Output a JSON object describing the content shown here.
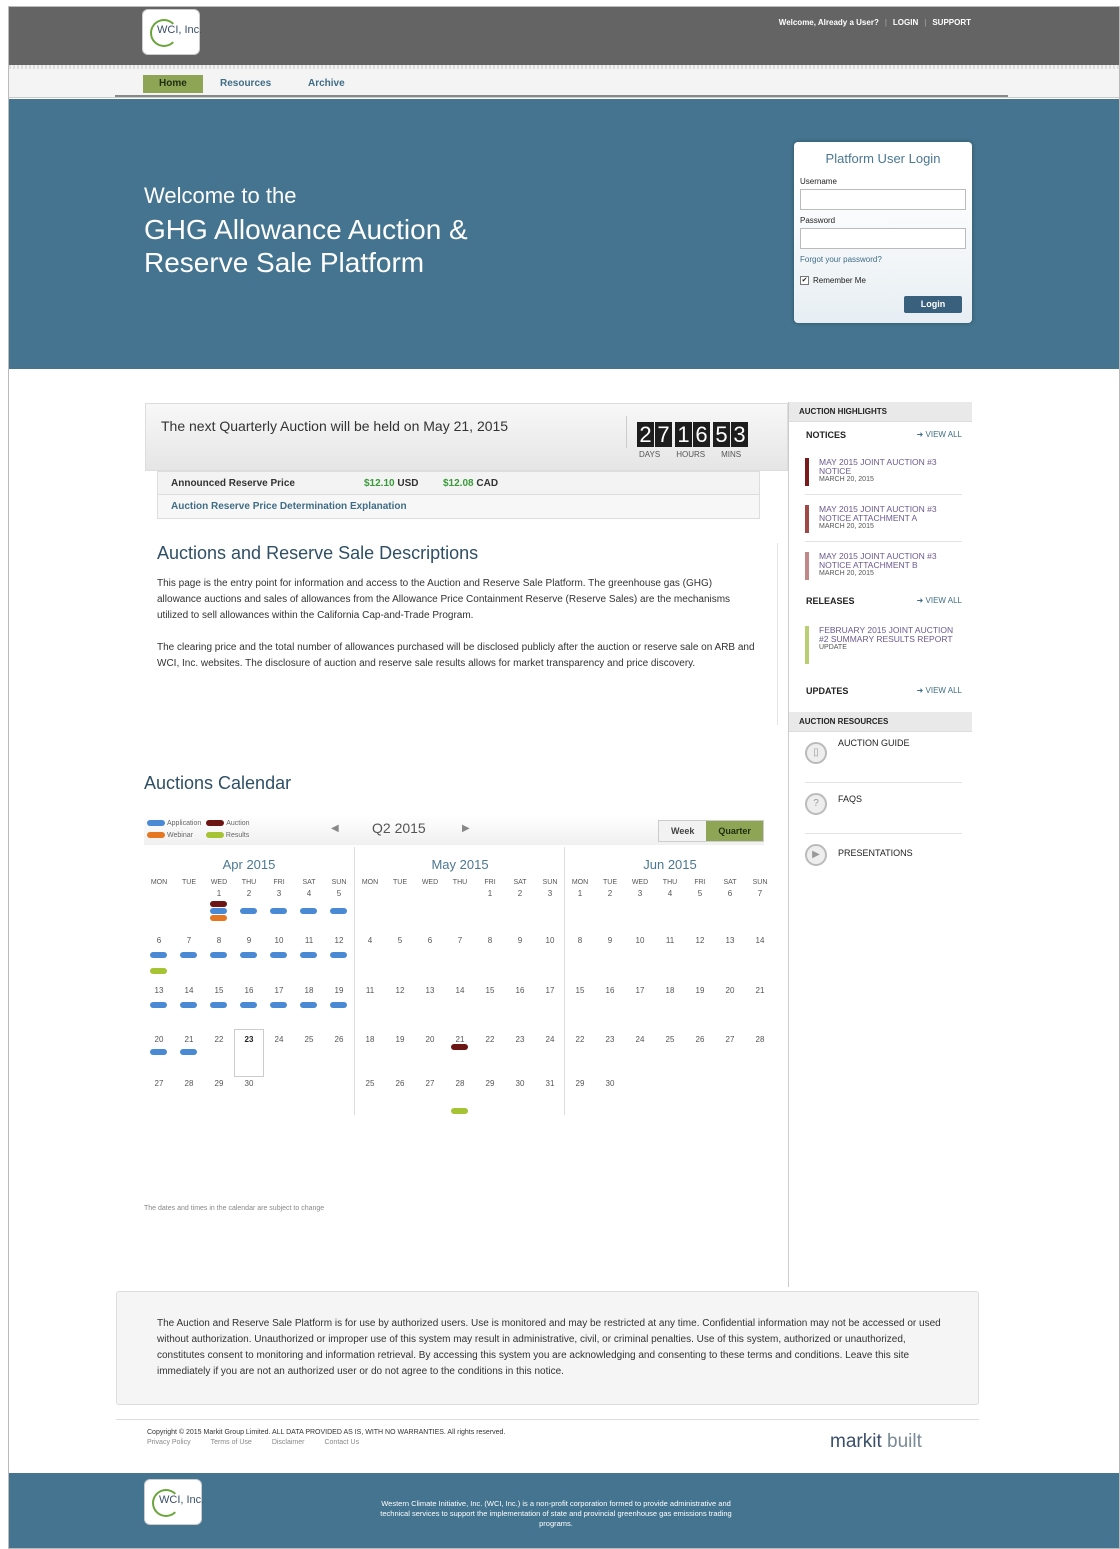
{
  "header": {
    "logo_text": "WCI, Inc.",
    "welcome": "Welcome, Already a User?",
    "login_link": "LOGIN",
    "support_link": "SUPPORT"
  },
  "nav": {
    "home": "Home",
    "resources": "Resources",
    "archive": "Archive"
  },
  "hero": {
    "line1": "Welcome to the",
    "line2": "GHG Allowance Auction &",
    "line3": "Reserve Sale Platform"
  },
  "login": {
    "title": "Platform User Login",
    "username_label": "Username",
    "password_label": "Password",
    "forgot": "Forgot your password?",
    "remember": "Remember Me",
    "button": "Login"
  },
  "auction": {
    "message": "The next Quarterly Auction will be held on May 21, 2015",
    "digits": [
      "2",
      "7",
      "1",
      "6",
      "5",
      "3"
    ],
    "labels": [
      "DAYS",
      "HOURS",
      "MINS"
    ],
    "reserve_label": "Announced Reserve Price",
    "usd_value": "$12.10",
    "usd_unit": "USD",
    "cad_value": "$12.08",
    "cad_unit": "CAD",
    "explanation_link": "Auction Reserve Price Determination Explanation"
  },
  "descriptions": {
    "title": "Auctions and Reserve Sale Descriptions",
    "p1": "This page is the entry point for information and access to the Auction and Reserve Sale Platform. The greenhouse gas (GHG) allowance auctions and sales of allowances from the Allowance Price Containment Reserve (Reserve Sales) are the mechanisms utilized to sell allowances within the California Cap-and-Trade Program.",
    "p2": "The clearing price and the total number of allowances purchased will be disclosed publicly after the auction or reserve sale on ARB and WCI, Inc. websites. The disclosure of auction and reserve sale results allows for market transparency and price discovery."
  },
  "calendar": {
    "title": "Auctions Calendar",
    "legend": {
      "application": "Application",
      "auction": "Auction",
      "webinar": "Webinar",
      "results": "Results"
    },
    "period": "Q2 2015",
    "week": "Week",
    "quarter": "Quarter",
    "months": [
      "Apr 2015",
      "May 2015",
      "Jun 2015"
    ],
    "dow": [
      "MON",
      "TUE",
      "WED",
      "THU",
      "FRI",
      "SAT",
      "SUN"
    ],
    "apr_days": [
      [
        "",
        "",
        "1",
        "2",
        "3",
        "4",
        "5"
      ],
      [
        "6",
        "7",
        "8",
        "9",
        "10",
        "11",
        "12"
      ],
      [
        "13",
        "14",
        "15",
        "16",
        "17",
        "18",
        "19"
      ],
      [
        "20",
        "21",
        "22",
        "23",
        "24",
        "25",
        "26"
      ],
      [
        "27",
        "28",
        "29",
        "30",
        "",
        "",
        ""
      ]
    ],
    "may_days": [
      [
        "",
        "",
        "",
        "",
        "1",
        "2",
        "3"
      ],
      [
        "4",
        "5",
        "6",
        "7",
        "8",
        "9",
        "10"
      ],
      [
        "11",
        "12",
        "13",
        "14",
        "15",
        "16",
        "17"
      ],
      [
        "18",
        "19",
        "20",
        "21",
        "22",
        "23",
        "24"
      ],
      [
        "25",
        "26",
        "27",
        "28",
        "29",
        "30",
        "31"
      ]
    ],
    "jun_days": [
      [
        "1",
        "2",
        "3",
        "4",
        "5",
        "6",
        "7"
      ],
      [
        "8",
        "9",
        "10",
        "11",
        "12",
        "13",
        "14"
      ],
      [
        "15",
        "16",
        "17",
        "18",
        "19",
        "20",
        "21"
      ],
      [
        "22",
        "23",
        "24",
        "25",
        "26",
        "27",
        "28"
      ],
      [
        "29",
        "30",
        "",
        "",
        "",
        "",
        ""
      ]
    ],
    "disclaimer": "The dates and times in the calendar are subject to change"
  },
  "sidebar": {
    "highlights": "AUCTION HIGHLIGHTS",
    "notices": "NOTICES",
    "view_all": "VIEW ALL",
    "notice_items": [
      {
        "title": "MAY 2015 JOINT AUCTION #3 NOTICE",
        "date": "MARCH 20, 2015",
        "color": "#7a1a1a"
      },
      {
        "title": "MAY 2015 JOINT AUCTION #3 NOTICE ATTACHMENT A",
        "date": "MARCH 20, 2015",
        "color": "#a04848"
      },
      {
        "title": "MAY 2015 JOINT AUCTION #3 NOTICE ATTACHMENT B",
        "date": "MARCH 20, 2015",
        "color": "#c08888"
      }
    ],
    "releases": "RELEASES",
    "release_items": [
      {
        "title": "FEBRUARY 2015 JOINT AUCTION #2 SUMMARY RESULTS REPORT",
        "date": "UPDATE",
        "color": "#b8cf72"
      }
    ],
    "updates": "UPDATES",
    "resources_head": "AUCTION RESOURCES",
    "resources": [
      "AUCTION GUIDE",
      "FAQS",
      "PRESENTATIONS"
    ]
  },
  "legal": "The Auction and Reserve Sale Platform is for use by authorized users. Use is monitored and may be restricted at any time. Confidential information may not be accessed or used without authorization. Unauthorized or improper use of this system may result in administrative, civil, or criminal penalties. Use of this system, authorized or unauthorized, constitutes consent to monitoring and information retrieval. By accessing this system you are acknowledging and consenting to these terms and conditions. Leave this site immediately if you are not an authorized user or do not agree to the conditions in this notice.",
  "footer": {
    "copyright": "Copyright © 2015 Markit Group Limited. ALL DATA PROVIDED AS IS, WITH NO WARRANTIES. All rights reserved.",
    "links": [
      "Privacy Policy",
      "Terms of Use",
      "Disclaimer",
      "Contact Us"
    ],
    "markit": "markit",
    "built": "built",
    "about": "Western Climate Initiative, Inc. (WCI, Inc.) is a non-profit corporation formed to provide administrative and technical services to support the implementation of state and provincial greenhouse gas emissions trading programs."
  }
}
